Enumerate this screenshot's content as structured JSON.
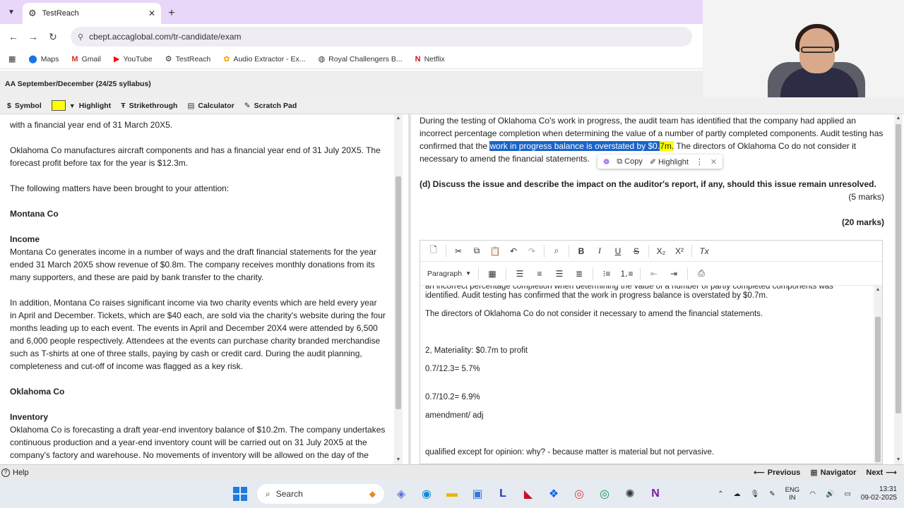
{
  "browser": {
    "tab_title": "TestReach",
    "url": "cbept.accaglobal.com/tr-candidate/exam",
    "bookmarks": [
      "Maps",
      "Gmail",
      "YouTube",
      "TestReach",
      "Audio Extractor - Ex...",
      "Royal Challengers B...",
      "Netflix"
    ]
  },
  "exam": {
    "header": "AA September/December (24/25 syllabus)",
    "toolbar": {
      "symbol": "Symbol",
      "highlight": "Highlight",
      "strikethrough": "Strikethrough",
      "calculator": "Calculator",
      "scratch_pad": "Scratch Pad",
      "highlight_color": "#ffff00"
    }
  },
  "left": {
    "p0": "with a financial year end of 31 March 20X5.",
    "p1": "Oklahoma Co manufactures aircraft components and has a financial year end of 31 July 20X5. The forecast profit before tax for the year is $12.3m.",
    "p2": "The following matters have been brought to your attention:",
    "h1": "Montana Co",
    "h2": "Income",
    "p3": "Montana Co generates income in a number of ways and the draft financial statements for the year ended 31 March 20X5 show revenue of $0.8m. The company receives monthly donations from its many supporters, and these are paid by bank transfer to the charity.",
    "p4": "In addition, Montana Co raises significant income via two charity events which are held every year in April and December. Tickets, which are $40 each, are sold via the charity's website during the four months leading up to each event. The events in April and December 20X4 were attended by 6,500 and 6,000 people respectively. Attendees at the events can purchase charity branded merchandise such as T-shirts at one of three stalls, paying by cash or credit card. During the audit planning, completeness and cut-off of income was flagged as a key risk.",
    "h3": "Oklahoma Co",
    "h4": "Inventory",
    "p5": "Oklahoma Co is forecasting a draft year-end inventory balance of $10.2m. The company undertakes continuous production and a year-end inventory count will be carried out on 31 July 20X5 at the company's factory and warehouse. No movements of inventory will be allowed on the day of the"
  },
  "right": {
    "para_a": "During the testing of Oklahoma Co's work in progress, the audit team has identified that the company had applied an incorrect percentage completion when determining the value of a number of partly completed components. Audit testing has confirmed that the ",
    "selected": "work in progress balance is overstated by $0.",
    "highlighted": "7m.",
    "para_b": " The directors of Oklahoma Co do not consider it necessary to amend the financial statements.",
    "question_d": "(d) Discuss the issue and describe the impact on the auditor's report, if any, should this issue remain unresolved.",
    "marks_d": "(5 marks)",
    "marks_total": "(20 marks)",
    "popup": {
      "copy": "Copy",
      "highlight": "Highlight"
    }
  },
  "editor": {
    "format_select": "Paragraph",
    "lines": [
      "an incorrect percentage completion when determining the value of a number of partly completed components was identified.  Audit testing has confirmed that the work in progress balance is overstated by $0.7m.",
      "The directors of Oklahoma Co do not consider it necessary to amend the financial statements.",
      "2, Materiality: $0.7m to profit",
      "0.7/12.3= 5.7%",
      "0.7/10.2= 6.9%",
      "amendment/ adj",
      "qualified except for opinion: why? - because matter is material but not pervasive."
    ]
  },
  "nav": {
    "help": "Help",
    "previous": "Previous",
    "navigator": "Navigator",
    "next": "Next"
  },
  "taskbar": {
    "search": "Search",
    "lang1": "ENG",
    "lang2": "IN",
    "time": "13:31",
    "date": "09-02-2025"
  }
}
